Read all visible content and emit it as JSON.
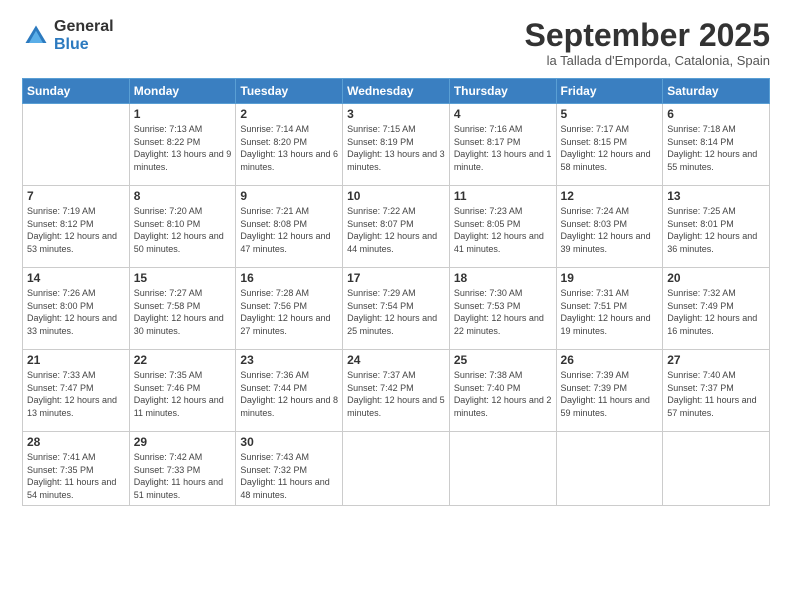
{
  "header": {
    "logo": {
      "general": "General",
      "blue": "Blue"
    },
    "title": "September 2025",
    "subtitle": "la Tallada d'Emporda, Catalonia, Spain"
  },
  "weekdays": [
    "Sunday",
    "Monday",
    "Tuesday",
    "Wednesday",
    "Thursday",
    "Friday",
    "Saturday"
  ],
  "weeks": [
    [
      {
        "day": "",
        "sunrise": "",
        "sunset": "",
        "daylight": ""
      },
      {
        "day": "1",
        "sunrise": "Sunrise: 7:13 AM",
        "sunset": "Sunset: 8:22 PM",
        "daylight": "Daylight: 13 hours and 9 minutes."
      },
      {
        "day": "2",
        "sunrise": "Sunrise: 7:14 AM",
        "sunset": "Sunset: 8:20 PM",
        "daylight": "Daylight: 13 hours and 6 minutes."
      },
      {
        "day": "3",
        "sunrise": "Sunrise: 7:15 AM",
        "sunset": "Sunset: 8:19 PM",
        "daylight": "Daylight: 13 hours and 3 minutes."
      },
      {
        "day": "4",
        "sunrise": "Sunrise: 7:16 AM",
        "sunset": "Sunset: 8:17 PM",
        "daylight": "Daylight: 13 hours and 1 minute."
      },
      {
        "day": "5",
        "sunrise": "Sunrise: 7:17 AM",
        "sunset": "Sunset: 8:15 PM",
        "daylight": "Daylight: 12 hours and 58 minutes."
      },
      {
        "day": "6",
        "sunrise": "Sunrise: 7:18 AM",
        "sunset": "Sunset: 8:14 PM",
        "daylight": "Daylight: 12 hours and 55 minutes."
      }
    ],
    [
      {
        "day": "7",
        "sunrise": "Sunrise: 7:19 AM",
        "sunset": "Sunset: 8:12 PM",
        "daylight": "Daylight: 12 hours and 53 minutes."
      },
      {
        "day": "8",
        "sunrise": "Sunrise: 7:20 AM",
        "sunset": "Sunset: 8:10 PM",
        "daylight": "Daylight: 12 hours and 50 minutes."
      },
      {
        "day": "9",
        "sunrise": "Sunrise: 7:21 AM",
        "sunset": "Sunset: 8:08 PM",
        "daylight": "Daylight: 12 hours and 47 minutes."
      },
      {
        "day": "10",
        "sunrise": "Sunrise: 7:22 AM",
        "sunset": "Sunset: 8:07 PM",
        "daylight": "Daylight: 12 hours and 44 minutes."
      },
      {
        "day": "11",
        "sunrise": "Sunrise: 7:23 AM",
        "sunset": "Sunset: 8:05 PM",
        "daylight": "Daylight: 12 hours and 41 minutes."
      },
      {
        "day": "12",
        "sunrise": "Sunrise: 7:24 AM",
        "sunset": "Sunset: 8:03 PM",
        "daylight": "Daylight: 12 hours and 39 minutes."
      },
      {
        "day": "13",
        "sunrise": "Sunrise: 7:25 AM",
        "sunset": "Sunset: 8:01 PM",
        "daylight": "Daylight: 12 hours and 36 minutes."
      }
    ],
    [
      {
        "day": "14",
        "sunrise": "Sunrise: 7:26 AM",
        "sunset": "Sunset: 8:00 PM",
        "daylight": "Daylight: 12 hours and 33 minutes."
      },
      {
        "day": "15",
        "sunrise": "Sunrise: 7:27 AM",
        "sunset": "Sunset: 7:58 PM",
        "daylight": "Daylight: 12 hours and 30 minutes."
      },
      {
        "day": "16",
        "sunrise": "Sunrise: 7:28 AM",
        "sunset": "Sunset: 7:56 PM",
        "daylight": "Daylight: 12 hours and 27 minutes."
      },
      {
        "day": "17",
        "sunrise": "Sunrise: 7:29 AM",
        "sunset": "Sunset: 7:54 PM",
        "daylight": "Daylight: 12 hours and 25 minutes."
      },
      {
        "day": "18",
        "sunrise": "Sunrise: 7:30 AM",
        "sunset": "Sunset: 7:53 PM",
        "daylight": "Daylight: 12 hours and 22 minutes."
      },
      {
        "day": "19",
        "sunrise": "Sunrise: 7:31 AM",
        "sunset": "Sunset: 7:51 PM",
        "daylight": "Daylight: 12 hours and 19 minutes."
      },
      {
        "day": "20",
        "sunrise": "Sunrise: 7:32 AM",
        "sunset": "Sunset: 7:49 PM",
        "daylight": "Daylight: 12 hours and 16 minutes."
      }
    ],
    [
      {
        "day": "21",
        "sunrise": "Sunrise: 7:33 AM",
        "sunset": "Sunset: 7:47 PM",
        "daylight": "Daylight: 12 hours and 13 minutes."
      },
      {
        "day": "22",
        "sunrise": "Sunrise: 7:35 AM",
        "sunset": "Sunset: 7:46 PM",
        "daylight": "Daylight: 12 hours and 11 minutes."
      },
      {
        "day": "23",
        "sunrise": "Sunrise: 7:36 AM",
        "sunset": "Sunset: 7:44 PM",
        "daylight": "Daylight: 12 hours and 8 minutes."
      },
      {
        "day": "24",
        "sunrise": "Sunrise: 7:37 AM",
        "sunset": "Sunset: 7:42 PM",
        "daylight": "Daylight: 12 hours and 5 minutes."
      },
      {
        "day": "25",
        "sunrise": "Sunrise: 7:38 AM",
        "sunset": "Sunset: 7:40 PM",
        "daylight": "Daylight: 12 hours and 2 minutes."
      },
      {
        "day": "26",
        "sunrise": "Sunrise: 7:39 AM",
        "sunset": "Sunset: 7:39 PM",
        "daylight": "Daylight: 11 hours and 59 minutes."
      },
      {
        "day": "27",
        "sunrise": "Sunrise: 7:40 AM",
        "sunset": "Sunset: 7:37 PM",
        "daylight": "Daylight: 11 hours and 57 minutes."
      }
    ],
    [
      {
        "day": "28",
        "sunrise": "Sunrise: 7:41 AM",
        "sunset": "Sunset: 7:35 PM",
        "daylight": "Daylight: 11 hours and 54 minutes."
      },
      {
        "day": "29",
        "sunrise": "Sunrise: 7:42 AM",
        "sunset": "Sunset: 7:33 PM",
        "daylight": "Daylight: 11 hours and 51 minutes."
      },
      {
        "day": "30",
        "sunrise": "Sunrise: 7:43 AM",
        "sunset": "Sunset: 7:32 PM",
        "daylight": "Daylight: 11 hours and 48 minutes."
      },
      {
        "day": "",
        "sunrise": "",
        "sunset": "",
        "daylight": ""
      },
      {
        "day": "",
        "sunrise": "",
        "sunset": "",
        "daylight": ""
      },
      {
        "day": "",
        "sunrise": "",
        "sunset": "",
        "daylight": ""
      },
      {
        "day": "",
        "sunrise": "",
        "sunset": "",
        "daylight": ""
      }
    ]
  ]
}
